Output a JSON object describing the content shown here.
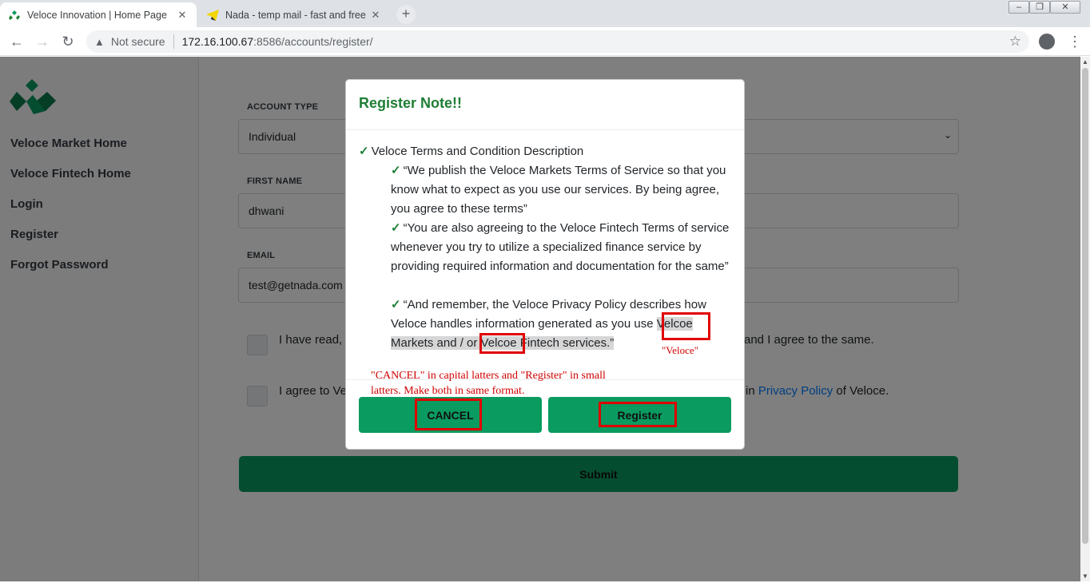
{
  "browser": {
    "tabs": [
      {
        "title": "Veloce Innovation | Home Page",
        "active": true
      },
      {
        "title": "Nada - temp mail - fast and free",
        "active": false
      }
    ],
    "new_tab": "+",
    "security_label": "Not secure",
    "url_host": "172.16.100.67",
    "url_rest": ":8586/accounts/register/"
  },
  "sidebar": {
    "items": [
      {
        "label": "Veloce Market Home"
      },
      {
        "label": "Veloce Fintech Home"
      },
      {
        "label": "Login"
      },
      {
        "label": "Register"
      },
      {
        "label": "Forgot Password"
      }
    ]
  },
  "form": {
    "account_type_label": "ACCOUNT TYPE",
    "account_type_value": "Individual",
    "first_name_label": "FIRST NAME",
    "first_name_value": "dhwani",
    "email_label": "EMAIL",
    "email_value": "test@getnada.com",
    "check1_text_start": "I have read,",
    "check1_text_end": "and I agree to the same.",
    "check2_text_start": "I agree to Ve",
    "check2_text_mid": "in",
    "check2_link": "Privacy Policy",
    "check2_text_end": "of Veloce.",
    "submit_label": "Submit"
  },
  "modal": {
    "title": "Register Note!!",
    "check_glyph": "✓",
    "heading": "Veloce Terms and Condition Description",
    "items": [
      {
        "text": "“We publish the Veloce Markets Terms of Service so that you know what to expect as you use our services. By being agree, you agree to these terms”"
      },
      {
        "text": "“You are also agreeing to the Veloce Fintech Terms of service whenever you try to utilize a specialized finance service by providing required information and documentation for the same”"
      },
      {
        "text_a": "“And remember, the Veloce Privacy Policy describes how Veloce handles information generated as you use ",
        "text_b": "Velcoe Markets and / or Velcoe Fintech services.”"
      }
    ],
    "cancel_label": "CANCEL",
    "register_label": "Register"
  },
  "annotations": {
    "note": "\"CANCEL\" in capital latters and \"Register\" in small latters. Make both in same format.",
    "veloce": "\"Veloce\""
  },
  "colors": {
    "brand_green": "#0a9b60",
    "title_green": "#1e7e34",
    "annotation_red": "#e00000"
  }
}
